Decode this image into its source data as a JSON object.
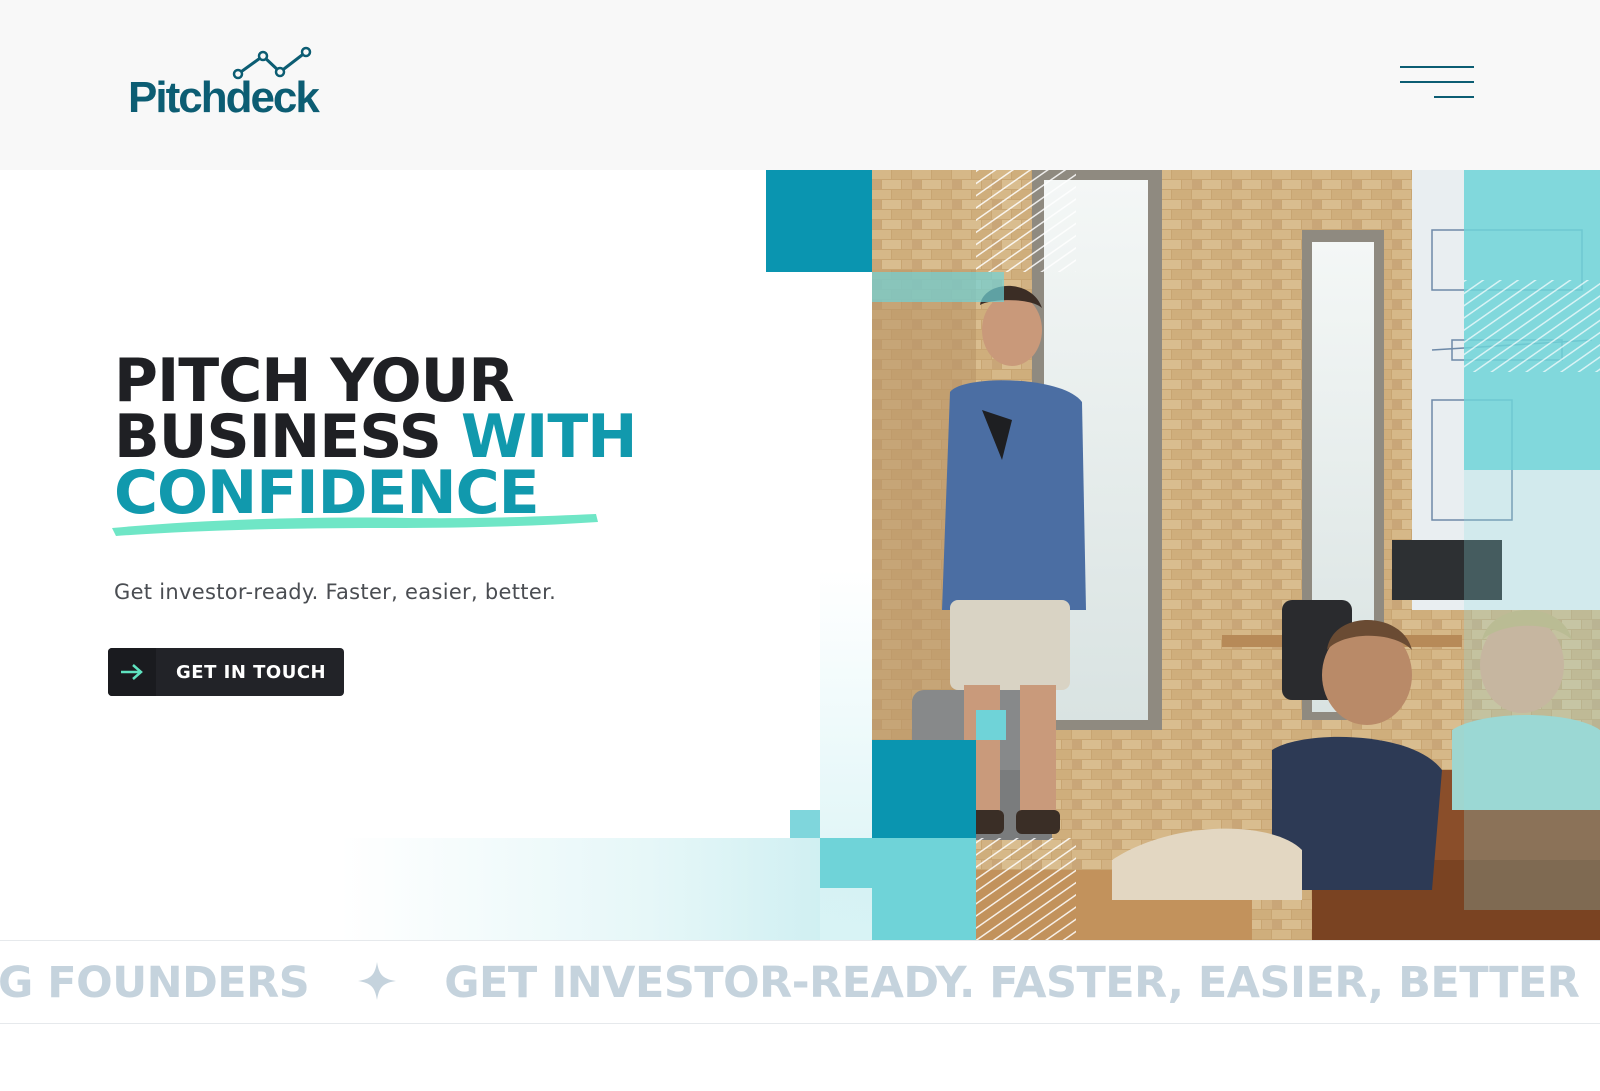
{
  "header": {
    "logo_text": "Pitchdeck",
    "menu_icon": "hamburger-menu-icon"
  },
  "hero": {
    "headline": {
      "line1": "PITCH YOUR",
      "line2_dark": "BUSINESS",
      "line2_teal": "WITH",
      "line3": "CONFIDENCE"
    },
    "subtext": "Get investor-ready. Faster, easier, better.",
    "cta_label": "GET IN TOUCH",
    "cta_icon": "arrow-right-icon"
  },
  "marquee": {
    "item1": "G FOUNDERS",
    "item2": "GET INVESTOR-READY. FASTER, EASIER, BETTER",
    "separator_icon": "four-point-star-icon"
  },
  "colors": {
    "brand_dark_teal": "#0c5d73",
    "accent_teal": "#1199ad",
    "light_teal": "#6fd3d8",
    "mint_brush": "#5fe3c0",
    "button_dark": "#222328",
    "marquee_text": "#c5d3dd"
  }
}
